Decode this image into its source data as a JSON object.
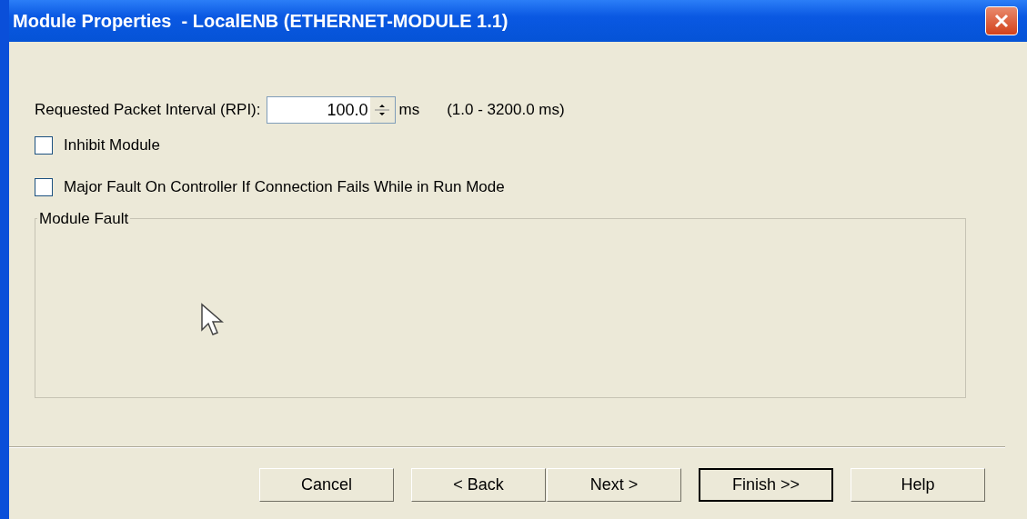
{
  "window": {
    "title": "Module Properties  - LocalENB (ETHERNET-MODULE 1.1)"
  },
  "rpi": {
    "label": "Requested Packet Interval (RPI):",
    "value": "100.0",
    "unit": "ms",
    "range": "(1.0 - 3200.0 ms)"
  },
  "checkboxes": [
    {
      "label": "Inhibit Module",
      "checked": false
    },
    {
      "label": "Major Fault On Controller If Connection Fails While in Run Mode",
      "checked": false
    }
  ],
  "group": {
    "title": "Module Fault"
  },
  "buttons": [
    {
      "label": "Cancel",
      "default": false
    },
    {
      "label": "< Back",
      "default": false
    },
    {
      "label": "Next >",
      "default": false
    },
    {
      "label": "Finish >>",
      "default": true
    },
    {
      "label": "Help",
      "default": false
    }
  ]
}
